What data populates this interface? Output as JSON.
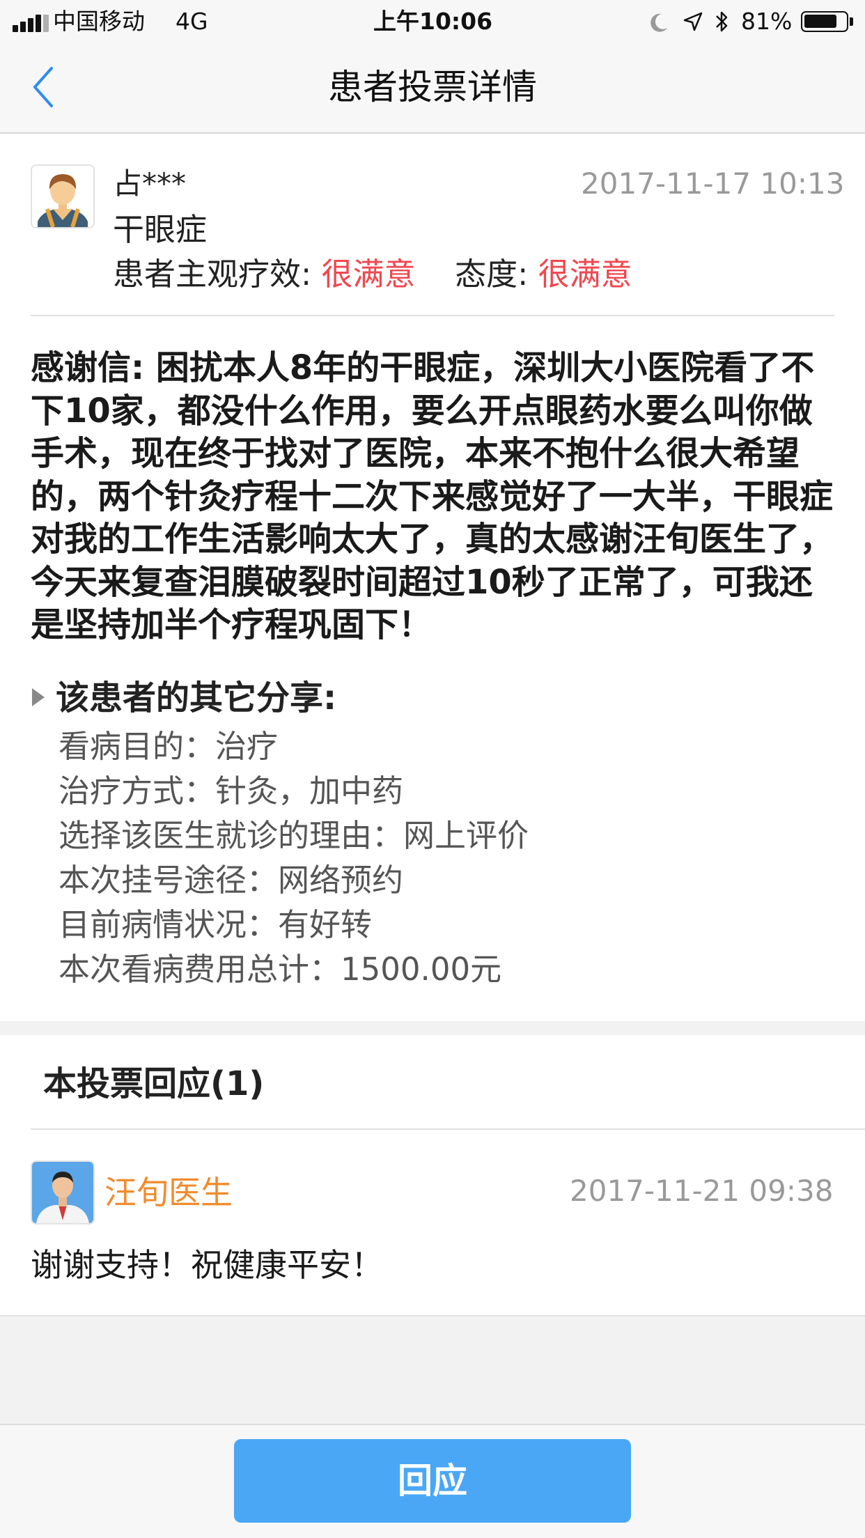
{
  "status_bar": {
    "carrier": "中国移动",
    "network": "4G",
    "time": "上午10:06",
    "battery": "81%",
    "battery_level": 0.81
  },
  "nav": {
    "title": "患者投票详情"
  },
  "review": {
    "patient_name": "占***",
    "date": "2017-11-17 10:13",
    "disease": "干眼症",
    "effect_label": "患者主观疗效:",
    "effect_value": "很满意",
    "attitude_label": "态度:",
    "attitude_value": "很满意",
    "letter": "感谢信: 困扰本人8年的干眼症，深圳大小医院看了不下10家，都没什么作用，要么开点眼药水要么叫你做手术，现在终于找对了医院，本来不抱什么很大希望的，两个针灸疗程十二次下来感觉好了一大半，干眼症对我的工作生活影响太大了，真的太感谢汪旬医生了，今天来复查泪膜破裂时间超过10秒了正常了，可我还是坚持加半个疗程巩固下！"
  },
  "share": {
    "title": "该患者的其它分享:",
    "items": [
      "看病目的：治疗",
      "治疗方式：针灸，加中药",
      "选择该医生就诊的理由：网上评价",
      "本次挂号途径：网络预约",
      "目前病情状况：有好转",
      "本次看病费用总计：1500.00元"
    ]
  },
  "replies": {
    "header": "本投票回应(1)",
    "items": [
      {
        "doctor_name": "汪旬医生",
        "date": "2017-11-21 09:38",
        "text": "谢谢支持！祝健康平安！"
      }
    ]
  },
  "bottom": {
    "reply_button": "回应"
  },
  "colors": {
    "accent_blue": "#4aa7f5",
    "rating_red": "#f0474f",
    "doctor_orange": "#f08c2e",
    "muted_gray": "#999999"
  }
}
